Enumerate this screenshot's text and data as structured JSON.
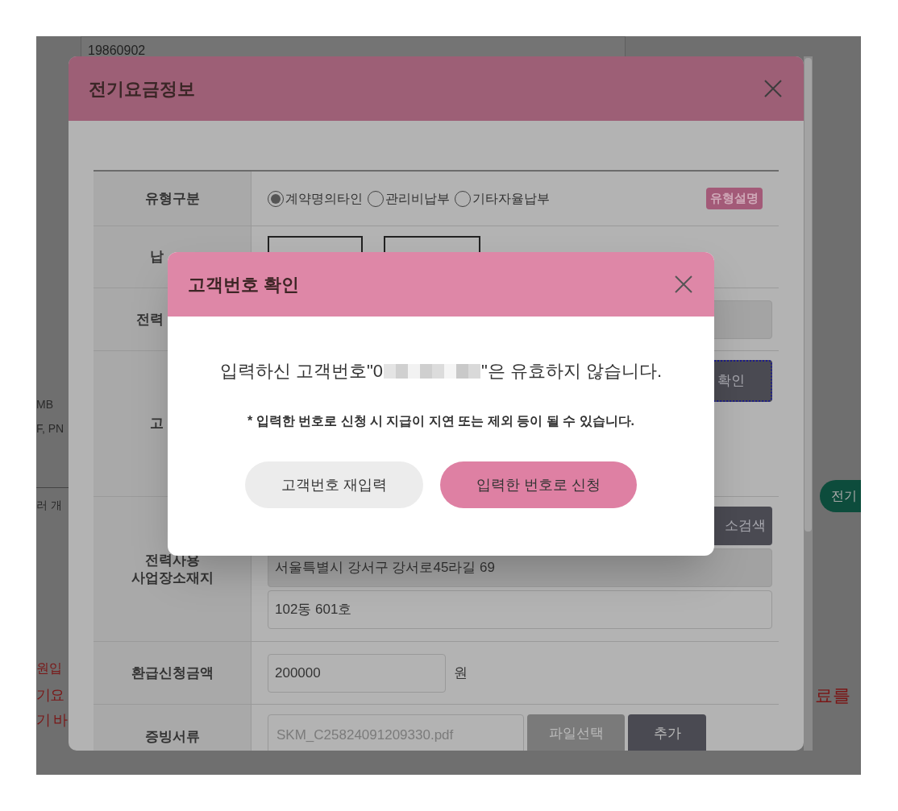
{
  "background_page": {
    "date_field": "19860902",
    "left_texts": [
      {
        "text": "MB",
        "kind": "plain"
      },
      {
        "text": "F, PN",
        "kind": "plain"
      },
      {
        "text": "러 개",
        "kind": "plain"
      },
      {
        "text": "원입",
        "kind": "warning"
      },
      {
        "text": "기요",
        "kind": "warning_large"
      },
      {
        "text": "기 바",
        "kind": "warning_large"
      }
    ],
    "right_button": "전기",
    "right_text": "료를"
  },
  "modal": {
    "title": "전기요금정보",
    "rows": [
      {
        "kind": "radio",
        "label": "유형구분",
        "options": [
          {
            "label": "계약명의타인",
            "selected": true
          },
          {
            "label": "관리비납부",
            "selected": false
          },
          {
            "label": "기타자율납부",
            "selected": false
          }
        ],
        "badge": "유형설명"
      },
      {
        "kind": "boxes",
        "label": "납"
      },
      {
        "kind": "input",
        "label": "전력"
      },
      {
        "kind": "button",
        "label": "고",
        "button": "확인"
      },
      {
        "kind": "address",
        "label": "전력사용\n사업장소재지",
        "button": "소검색",
        "address": "서울특별시 강서구 강서로45라길 69",
        "detail": "102동 601호"
      },
      {
        "kind": "amount",
        "label": "환급신청금액",
        "value": "200000",
        "unit": "원"
      },
      {
        "kind": "file",
        "label": "증빙서류",
        "value": "SKM_C25824091209330.pdf",
        "buttons": [
          "파일선택",
          "추가"
        ]
      }
    ]
  },
  "dialog": {
    "title": "고객번호 확인",
    "message_start": "입력하신 고객번호\"0",
    "message_end": "\"은 유효하지 않습니다.",
    "note": "* 입력한 번호로 신청 시 지급이 지연 또는 제외 등이 될 수 있습니다.",
    "buttons": [
      {
        "label": "고객번호 재입력",
        "primary": false
      },
      {
        "label": "입력한 번호로 신청",
        "primary": true
      }
    ]
  }
}
